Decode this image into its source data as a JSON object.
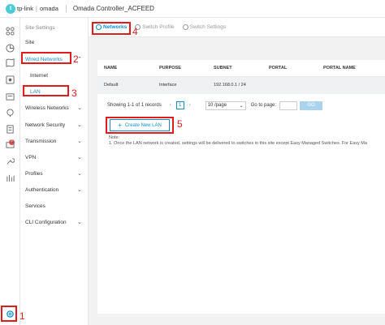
{
  "topbar": {
    "brand": "tp-link",
    "product": "omada",
    "site_name": "Omada Controller_ACFEED"
  },
  "rail_icons": [
    "dashboard-icon",
    "statistics-icon",
    "map-icon",
    "devices-icon",
    "clients-icon",
    "insight-icon",
    "log-icon",
    "tools-icon",
    "hotspot-icon",
    "settings-icon"
  ],
  "rail_badge": "2",
  "menu": {
    "header": "Site Settings",
    "items": [
      {
        "label": "Site"
      },
      {
        "label": "Wired Networks"
      },
      {
        "label": "Internet"
      },
      {
        "label": "LAN"
      },
      {
        "label": "Wireless Networks"
      },
      {
        "label": "Network Security"
      },
      {
        "label": "Transmission"
      },
      {
        "label": "VPN"
      },
      {
        "label": "Profiles"
      },
      {
        "label": "Authentication"
      },
      {
        "label": "Services"
      },
      {
        "label": "CLI Configuration"
      }
    ]
  },
  "tabs": [
    {
      "label": "Networks"
    },
    {
      "label": "Switch Profile"
    },
    {
      "label": "Switch Settings"
    }
  ],
  "table": {
    "headers": [
      "NAME",
      "PURPOSE",
      "SUBNET",
      "PORTAL",
      "PORTAL NAME"
    ],
    "rows": [
      [
        "Default",
        "Interface",
        "192.168.0.1 / 24",
        "",
        ""
      ]
    ]
  },
  "pager": {
    "summary": "Showing 1-1 of 1 records",
    "prev": "‹",
    "page": "1",
    "next": "›",
    "per_page": "10 /page",
    "goto_label": "Go to page:",
    "go_label": "GO"
  },
  "create_button": "Create New LAN",
  "note": {
    "title": "Note:",
    "line1": "1. Once the LAN network is created, settings will be delivered to switches in this site except Easy Managed Switches. For Easy Ma"
  },
  "annotations": [
    "1",
    "2",
    "3",
    "4",
    "5"
  ],
  "colors": {
    "accent": "#0d8fd6",
    "highlight": "#e21b1b",
    "badge": "#e84a4a"
  }
}
